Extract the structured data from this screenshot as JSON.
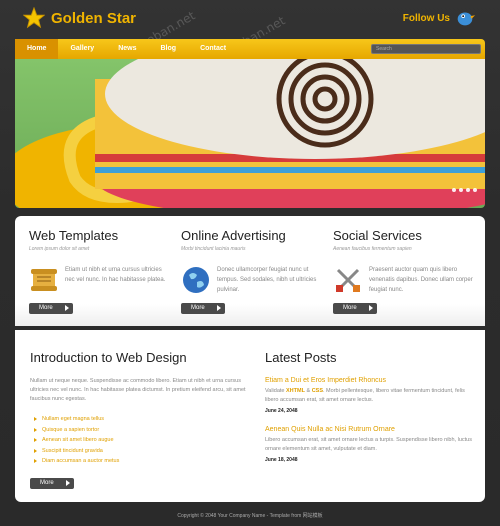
{
  "brand": {
    "name": "Golden Star"
  },
  "follow": {
    "label": "Follow Us"
  },
  "nav": {
    "items": [
      "Home",
      "Gallery",
      "News",
      "Blog",
      "Contact"
    ],
    "search_placeholder": "Search"
  },
  "features": [
    {
      "title": "Web Templates",
      "subtitle": "Lorem ipsum dolor sit amet",
      "text": "Etiam ut nibh et urna cursus ultricies nec vel nunc. In hac habitasse platea.",
      "more": "More"
    },
    {
      "title": "Online Advertising",
      "subtitle": "Morbi tincidunt lacinia mauris",
      "text": "Donec ullamcorper feugiat nunc ut tempus. Sed sodales, nibh ut ultricies pulvinar.",
      "more": "More"
    },
    {
      "title": "Social Services",
      "subtitle": "Aenean faucibus fermentum sapien",
      "text": "Praesent auctor quam quis libero venenatis dapibus. Donec ullam corper feugiat nunc.",
      "more": "More"
    }
  ],
  "intro": {
    "title": "Introduction to Web Design",
    "paragraph": "Nullam ut neque neque. Suspendisse ac commodo libero. Etiam ut nibh et urna cursus ultricies nec vel nunc. In hac habitasse platea dictumst. In pretium eleifend arcu, sit amet faucibus nunc egestas.",
    "list": [
      "Nullam eget magna tellus",
      "Quisque a sapien tortor",
      "Aenean sit amet libero augue",
      "Suscipit tincidunt gravida",
      "Diam accumsan a auctor metus"
    ],
    "more": "More"
  },
  "posts": {
    "title": "Latest Posts",
    "items": [
      {
        "title": "Etiam a Dui et Eros Imperdiet Rhoncus",
        "pre": "Validate ",
        "xhtml": "XHTML",
        "and": " & ",
        "css": "CSS",
        "rest": ". Morbi pellentesque, libero vitae fermentum tincidunt, felis libero accumsan erat, sit amet ornare lectus.",
        "date": "June 24, 2048"
      },
      {
        "title": "Aenean Quis Nulla ac Nisi Rutrum Ornare",
        "text": "Libero accumsan erat, sit amet ornare lectus a turpis. Suspendisse libero nibh, luctus ornare elementum sit amet, vulputate et diam.",
        "date": "June 18, 2048"
      }
    ]
  },
  "footer": {
    "text": "Copyright © 2048 Your Company Name - Template from 网站模板"
  },
  "watermark": "webmoban.net",
  "colors": {
    "accent": "#f0b400",
    "dark": "#2a2a2a"
  }
}
